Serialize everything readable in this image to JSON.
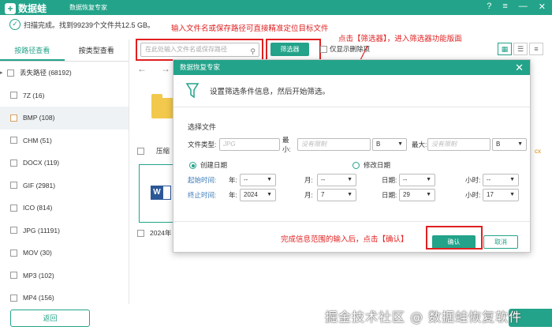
{
  "app": {
    "name": "数据蛙",
    "subtitle": "数据恢复专家",
    "window_buttons": [
      "?",
      "≡",
      "—",
      "✕"
    ]
  },
  "scan": {
    "status": "扫描完成。找到99239个文件共12.5 GB。"
  },
  "left_panel": {
    "tabs": [
      "按路径查看",
      "按类型查看"
    ],
    "active_tab": 0,
    "root": "丢失路径 (68192)",
    "items": [
      "7Z (16)",
      "BMP (108)",
      "CHM (51)",
      "DOCX (119)",
      "GIF (2981)",
      "ICO (814)",
      "JPG (11191)",
      "MOV (30)",
      "MP3 (102)",
      "MP4 (156)"
    ],
    "selected_index": 1
  },
  "toolbar": {
    "search_placeholder": "在此处输入文件名或保存路径",
    "filter_button": "筛选器",
    "only_deleted_label": "仅显示删除项",
    "view_icons": [
      "grid-view-icon",
      "list-view-icon",
      "detail-view-icon"
    ]
  },
  "annotations": {
    "search_hint": "输入文件名或保存路径可直接精准定位目标文件",
    "filter_hint": "点击【筛选器】，进入筛选器功能版面",
    "confirm_hint": "完成信息范围的输入后，点击【确认】"
  },
  "content": {
    "file1_label": "压缩",
    "file2_label": "2024年",
    "side_text": "cx"
  },
  "dialog": {
    "title": "数据恢复专家",
    "header": "设置筛选条件信息，然后开始筛选。",
    "section": "选择文件",
    "file_type_label": "文件类型:",
    "file_type_placeholder": "JPG",
    "min_label": "最小:",
    "max_label": "最大:",
    "size_placeholder": "没有限制",
    "unit_min": "B",
    "unit_max": "B",
    "created_label": "创建日期",
    "modified_label": "修改日期",
    "start_label": "起始时间:",
    "end_label": "终止时间:",
    "year_label": "年:",
    "month_label": "月:",
    "day_label": "日期:",
    "hour_label": "小时:",
    "start": {
      "year": "--",
      "month": "--",
      "day": "--",
      "hour": "--"
    },
    "end": {
      "year": "2024",
      "month": "7",
      "day": "29",
      "hour": "17"
    },
    "ok_button": "确认",
    "cancel_button": "取消"
  },
  "footer": {
    "back_button": "返回",
    "watermark": "掘金技术社区 @ 数据蛙恢复软件"
  },
  "colors": {
    "accent": "#23a38a",
    "annotation_red": "#e02020"
  }
}
